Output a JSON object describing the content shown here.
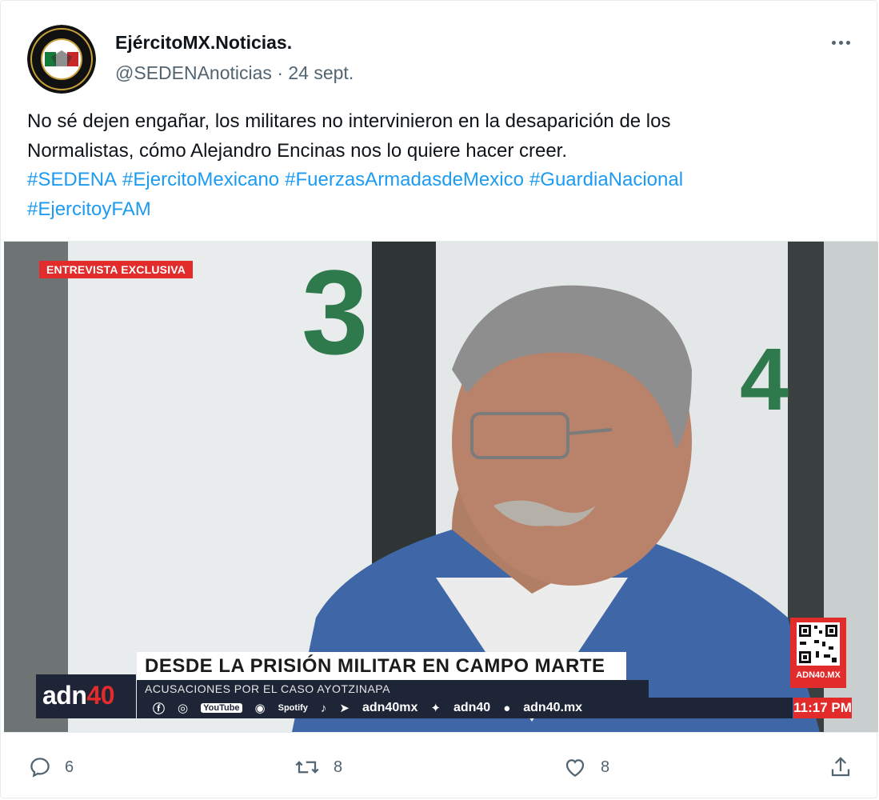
{
  "author": {
    "name": "EjércitoMX.Noticias.",
    "handle": "@SEDENAnoticias",
    "separator": "·",
    "date": "24 sept."
  },
  "tweet": {
    "line1": "No sé dejen engañar, los militares no intervinieron en la desaparición de los",
    "line2": "Normalistas, cómo Alejandro Encinas nos lo quiere hacer  creer.",
    "hashtags": [
      "#SEDENA",
      "#EjercitoMexicano",
      "#FuerzasArmadasdeMexico",
      "#GuardiaNacional",
      "#EjercitoyFAM"
    ]
  },
  "media": {
    "badge": "ENTREVISTA EXCLUSIVA",
    "wall_numbers": [
      "3",
      "4"
    ],
    "headline": "DESDE LA PRISIÓN MILITAR EN CAMPO MARTE",
    "subheadline": "ACUSACIONES POR EL CASO AYOTZINAPA",
    "logo_main": "adn",
    "logo_accent": "40",
    "social_youtube": "YouTube",
    "social_spotify": "Spotify",
    "handle_1": "adn40mx",
    "handle_2": "adn40",
    "site": "adn40.mx",
    "time": "11:17 PM",
    "qr_label": "ADN40.MX"
  },
  "actions": {
    "replies": "6",
    "retweets": "8",
    "likes": "8"
  },
  "colors": {
    "link": "#1d9bf0",
    "muted": "#536471",
    "accent_red": "#e22b2b",
    "ticker_navy": "#1d2536"
  }
}
